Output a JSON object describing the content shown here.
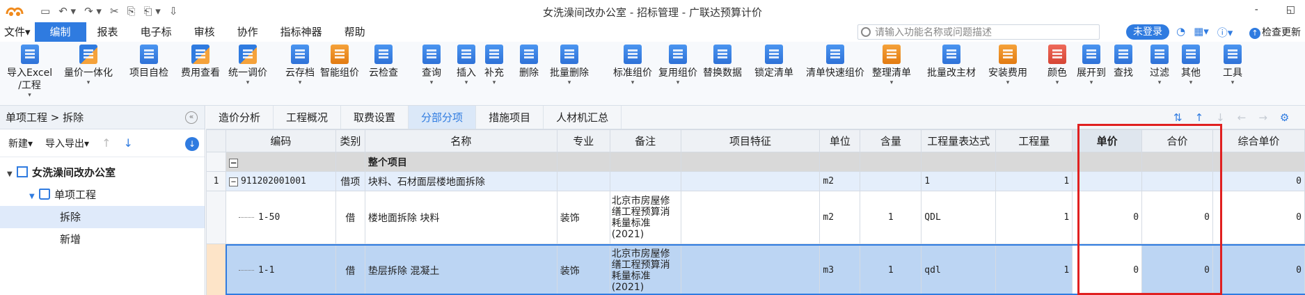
{
  "window": {
    "title": "女洗澡间改办公室 - 招标管理 - 广联达预算计价",
    "minimize_label": "-",
    "restore_label": "◱"
  },
  "quick_access": [
    "▭",
    "↶ ▾",
    "↷ ▾",
    "✂",
    "⎘",
    "⎗ ▾",
    "⇩"
  ],
  "menu": {
    "items": [
      "文件▾",
      "编制",
      "报表",
      "电子标",
      "审核",
      "协作",
      "指标神器",
      "帮助"
    ],
    "active_index": 1,
    "search_placeholder": "请输入功能名称或问题描述",
    "login_label": "未登录",
    "check_update_label": "检查更新"
  },
  "ribbon": {
    "buttons": [
      {
        "label": "导入Excel",
        "label2": "/工程",
        "caret": true,
        "icon": "import-excel-icon",
        "color": "blue"
      },
      {
        "label": "量价一体化",
        "caret": true,
        "icon": "quantity-price-icon",
        "color": "mix"
      },
      {
        "label": "项目自检",
        "caret": false,
        "icon": "self-check-icon",
        "color": "blue"
      },
      {
        "label": "费用查看",
        "caret": false,
        "icon": "fee-view-icon",
        "color": "mix"
      },
      {
        "label": "统一调价",
        "caret": true,
        "icon": "unify-price-icon",
        "color": "mix"
      },
      {
        "label": "云存档",
        "caret": true,
        "icon": "cloud-save-icon",
        "color": "blue"
      },
      {
        "label": "智能组价",
        "caret": false,
        "icon": "smart-price-icon",
        "color": "orange"
      },
      {
        "label": "云检查",
        "caret": false,
        "icon": "cloud-check-icon",
        "color": "blue"
      },
      {
        "label": "查询",
        "caret": true,
        "icon": "query-icon",
        "color": "blue"
      },
      {
        "label": "插入",
        "caret": true,
        "icon": "insert-icon",
        "color": "blue"
      },
      {
        "label": "补充",
        "caret": true,
        "icon": "supplement-icon",
        "color": "blue"
      },
      {
        "label": "删除",
        "caret": false,
        "icon": "delete-icon",
        "color": "blue"
      },
      {
        "label": "批量删除",
        "caret": true,
        "icon": "batch-delete-icon",
        "color": "blue"
      },
      {
        "label": "标准组价",
        "caret": true,
        "icon": "standard-price-icon",
        "color": "blue"
      },
      {
        "label": "复用组价",
        "caret": true,
        "icon": "reuse-price-icon",
        "color": "blue"
      },
      {
        "label": "替换数据",
        "caret": false,
        "icon": "replace-data-icon",
        "color": "blue"
      },
      {
        "label": "锁定清单",
        "caret": false,
        "icon": "lock-list-icon",
        "color": "blue"
      },
      {
        "label": "清单快速组价",
        "caret": false,
        "icon": "quick-price-icon",
        "color": "blue"
      },
      {
        "label": "整理清单",
        "caret": true,
        "icon": "organize-list-icon",
        "color": "orange"
      },
      {
        "label": "批量改主材",
        "caret": false,
        "icon": "batch-material-icon",
        "color": "blue"
      },
      {
        "label": "安装费用",
        "caret": true,
        "icon": "install-fee-icon",
        "color": "orange"
      },
      {
        "label": "颜色",
        "caret": true,
        "icon": "color-icon",
        "color": "red"
      },
      {
        "label": "展开到",
        "caret": true,
        "icon": "expand-to-icon",
        "color": "blue"
      },
      {
        "label": "查找",
        "caret": false,
        "icon": "find-icon",
        "color": "blue"
      },
      {
        "label": "过滤",
        "caret": true,
        "icon": "filter-icon",
        "color": "blue"
      },
      {
        "label": "其他",
        "caret": true,
        "icon": "other-icon",
        "color": "blue"
      },
      {
        "label": "工具",
        "caret": true,
        "icon": "tools-icon",
        "color": "blue"
      }
    ]
  },
  "left_panel": {
    "breadcrumb": "单项工程 > 拆除",
    "new_label": "新建▾",
    "import_export_label": "导入导出▾",
    "tree": [
      {
        "label": "女洗澡间改办公室",
        "level": 0
      },
      {
        "label": "单项工程",
        "level": 1
      },
      {
        "label": "拆除",
        "level": 2,
        "selected": true
      },
      {
        "label": "新增",
        "level": 2
      }
    ]
  },
  "tabs": {
    "items": [
      "造价分析",
      "工程概况",
      "取费设置",
      "分部分项",
      "措施项目",
      "人材机汇总"
    ],
    "active_index": 3
  },
  "grid": {
    "columns": [
      "",
      "编码",
      "类别",
      "名称",
      "专业",
      "备注",
      "项目特征",
      "单位",
      "含量",
      "工程量表达式",
      "工程量",
      "单价",
      "合价",
      "综合单价"
    ],
    "group_row": {
      "name": "整个项目"
    },
    "bill_row": {
      "index": "1",
      "code": "911202001001",
      "type": "借项",
      "name": "块料、石材面层楼地面拆除",
      "unit": "m2",
      "expr": "1",
      "qty": "1",
      "unit_price": "",
      "total": "",
      "comp_price": "0"
    },
    "quota_rows": [
      {
        "index": "",
        "code": "1-50",
        "type": "借",
        "name": "楼地面拆除 块料",
        "spec": "装饰",
        "note": "北京市房屋修缮工程预算消耗量标准(2021)",
        "unit": "m2",
        "content": "1",
        "expr": "QDL",
        "qty": "1",
        "unit_price": "0",
        "total": "0",
        "comp_price": "0",
        "selected": false
      },
      {
        "index": "",
        "code": "1-1",
        "type": "借",
        "name": "垫层拆除 混凝土",
        "spec": "装饰",
        "note": "北京市房屋修缮工程预算消耗量标准(2021)",
        "unit": "m3",
        "content": "1",
        "expr": "qdl",
        "qty": "1",
        "unit_price": "0",
        "total": "0",
        "comp_price": "0",
        "selected": true
      }
    ]
  }
}
